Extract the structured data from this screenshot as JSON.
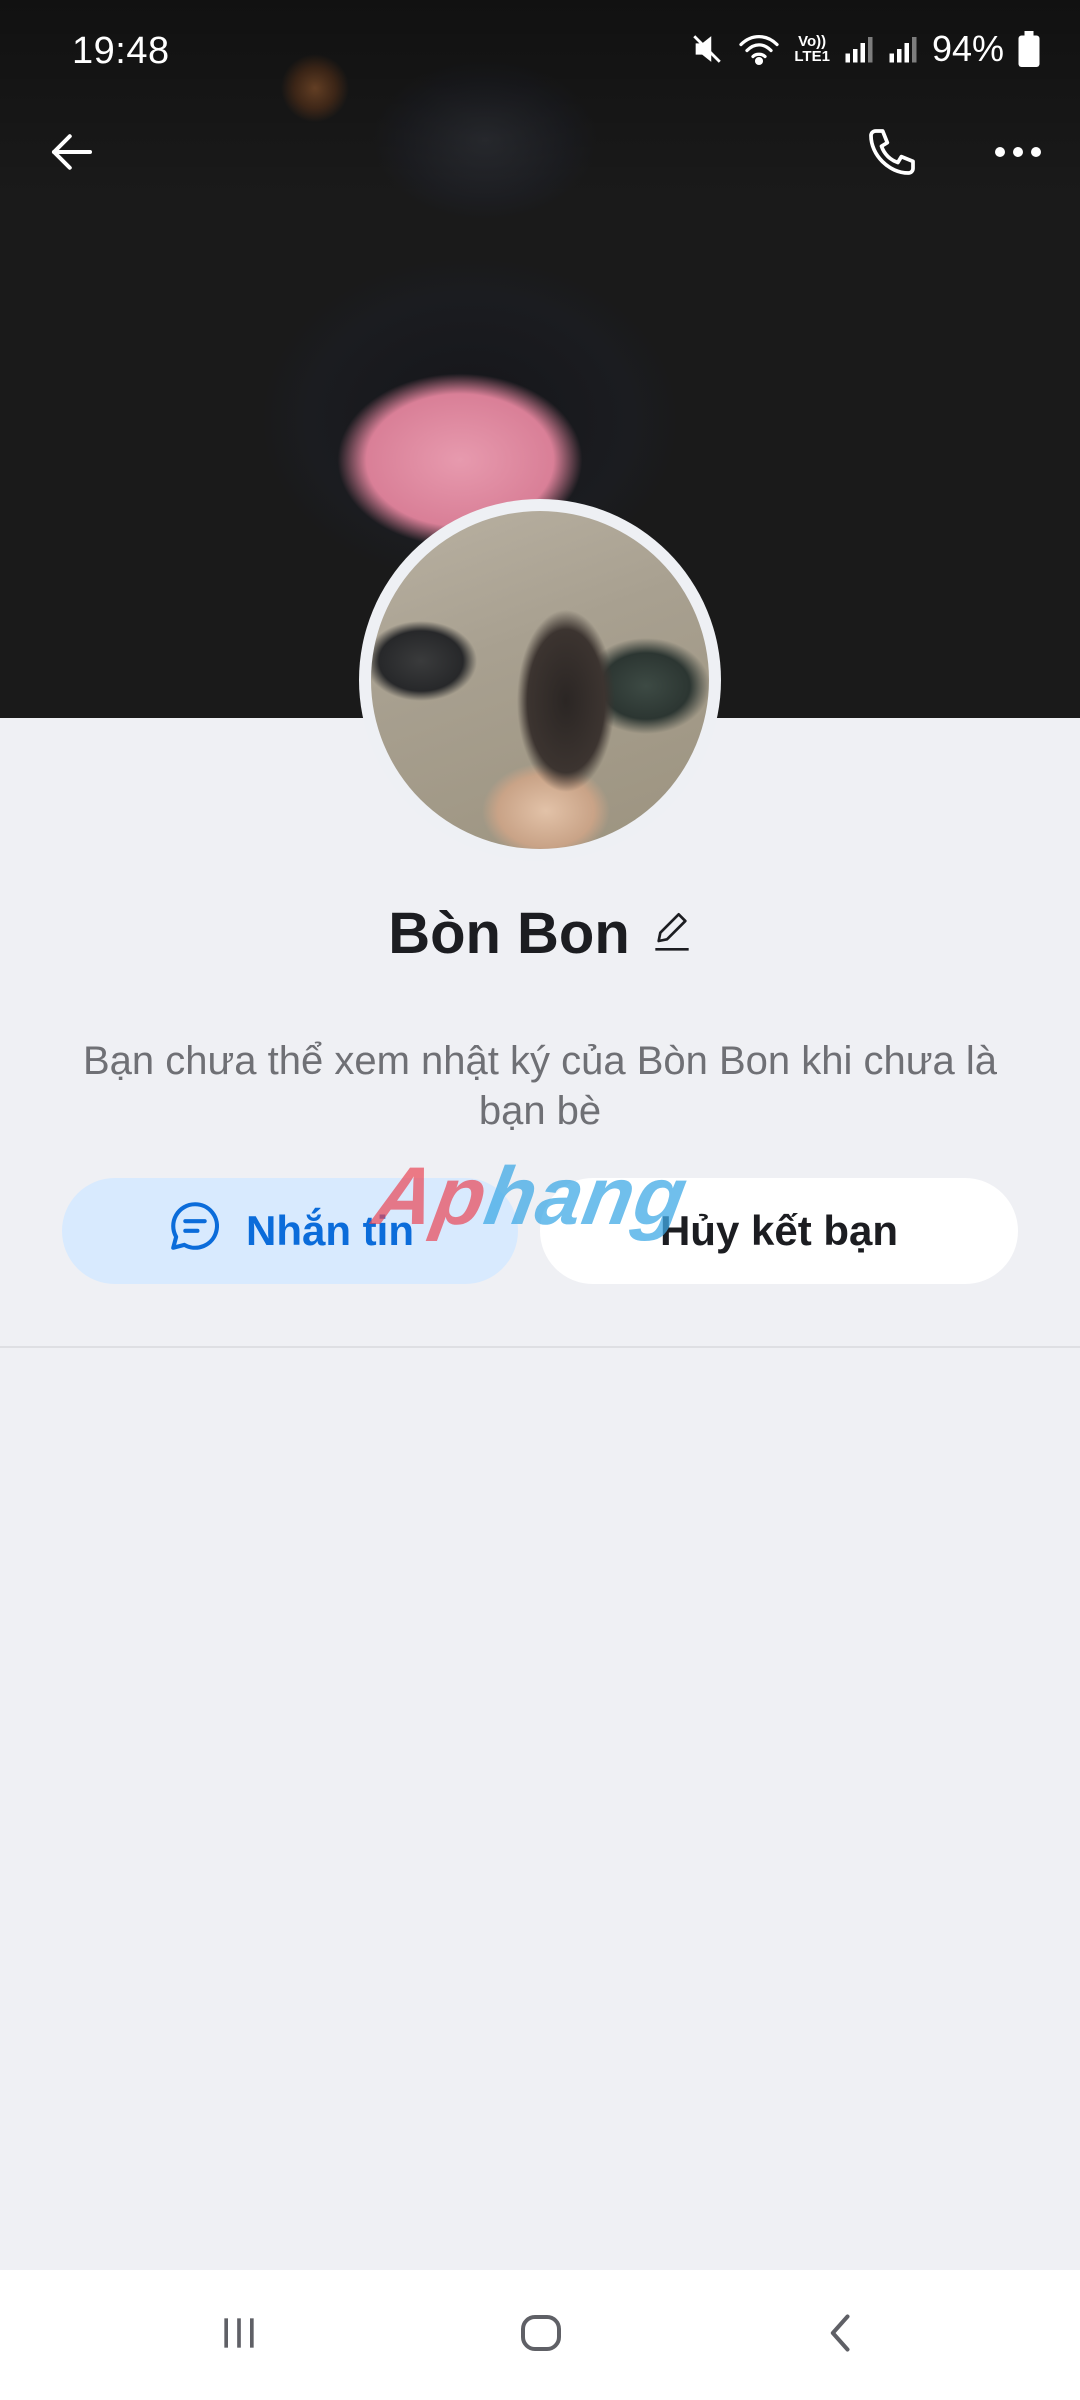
{
  "status_bar": {
    "time": "19:48",
    "volte_top": "Vo))",
    "volte_bottom": "LTE1",
    "battery": "94%",
    "icons": [
      "mute-icon",
      "wifi-icon",
      "signal-icon",
      "signal-icon",
      "battery-icon"
    ]
  },
  "top_bar": {
    "icons": [
      "back-arrow-icon",
      "phone-icon",
      "more-icon"
    ]
  },
  "profile": {
    "name": "Bòn Bon",
    "info": "Bạn chưa thể xem nhật ký của Bòn Bon khi chưa là bạn bè"
  },
  "actions": {
    "message_label": "Nhắn tin",
    "unfriend_label": "Hủy kết bạn"
  },
  "watermark": {
    "part1": "Ap",
    "part2": "hang"
  },
  "colors": {
    "accent": "#0b6cda",
    "message_bg": "#d8eafe",
    "page_bg": "#eff0f4"
  }
}
